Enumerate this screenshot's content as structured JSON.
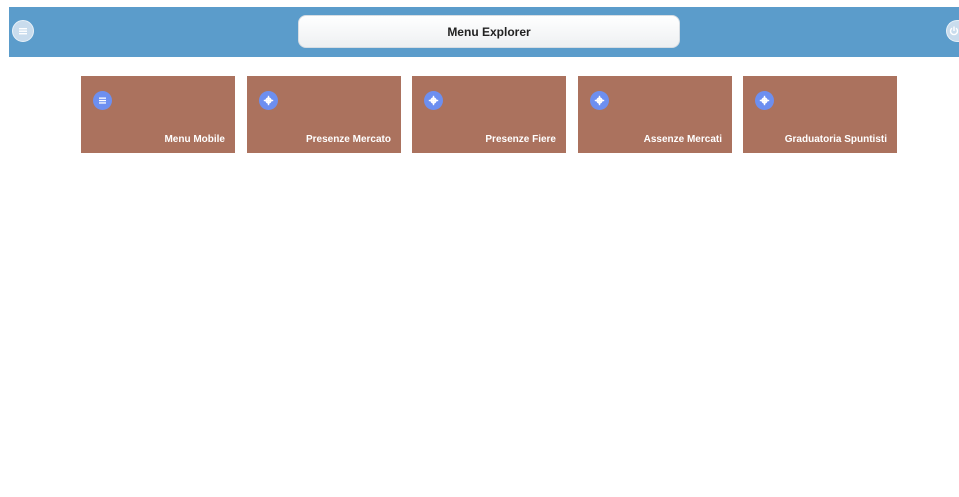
{
  "header": {
    "title": "Menu Explorer",
    "left_icon": "menu-list-icon",
    "right_icon": "power-icon",
    "color": "#5b9ccb"
  },
  "tiles": [
    {
      "label": "Menu Mobile",
      "icon": "list-icon"
    },
    {
      "label": "Presenze Mercato",
      "icon": "gear-icon"
    },
    {
      "label": "Presenze Fiere",
      "icon": "gear-icon"
    },
    {
      "label": "Assenze Mercati",
      "icon": "gear-icon"
    },
    {
      "label": "Graduatoria Spuntisti",
      "icon": "gear-icon"
    }
  ],
  "colors": {
    "tile": "#ab725e",
    "tile_icon": "#6d8ff0"
  }
}
